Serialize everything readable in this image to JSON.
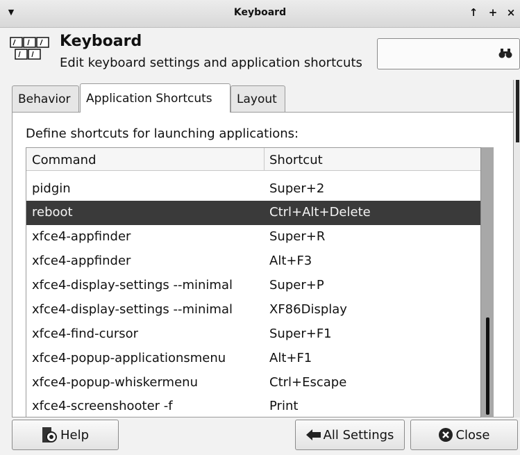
{
  "window": {
    "title": "Keyboard",
    "buttons": [
      "↑",
      "+",
      "×"
    ]
  },
  "header": {
    "title": "Keyboard",
    "subtitle": "Edit keyboard settings and application shortcuts",
    "search_placeholder": "",
    "search_icon": "binoculars-icon"
  },
  "tabs": [
    {
      "label": "Behavior",
      "active": false
    },
    {
      "label": "Application Shortcuts",
      "active": true
    },
    {
      "label": "Layout",
      "active": false
    }
  ],
  "content": {
    "prompt": "Define shortcuts for launching applications:",
    "columns": [
      "Command",
      "Shortcut"
    ],
    "rows": [
      {
        "command": "pidgin",
        "shortcut": "Super+2",
        "selected": false
      },
      {
        "command": "reboot",
        "shortcut": "Ctrl+Alt+Delete",
        "selected": true
      },
      {
        "command": "xfce4-appfinder",
        "shortcut": "Super+R",
        "selected": false
      },
      {
        "command": "xfce4-appfinder",
        "shortcut": "Alt+F3",
        "selected": false
      },
      {
        "command": "xfce4-display-settings --minimal",
        "shortcut": "Super+P",
        "selected": false
      },
      {
        "command": "xfce4-display-settings --minimal",
        "shortcut": "XF86Display",
        "selected": false
      },
      {
        "command": "xfce4-find-cursor",
        "shortcut": "Super+F1",
        "selected": false
      },
      {
        "command": "xfce4-popup-applicationsmenu",
        "shortcut": "Alt+F1",
        "selected": false
      },
      {
        "command": "xfce4-popup-whiskermenu",
        "shortcut": "Ctrl+Escape",
        "selected": false
      },
      {
        "command": "xfce4-screenshooter -f",
        "shortcut": "Print",
        "selected": false
      }
    ]
  },
  "buttons": {
    "help": "Help",
    "all_settings": "All Settings",
    "close": "Close"
  },
  "colors": {
    "selected_row": "#3a3a3a",
    "window_bg": "#f2f2f2"
  }
}
